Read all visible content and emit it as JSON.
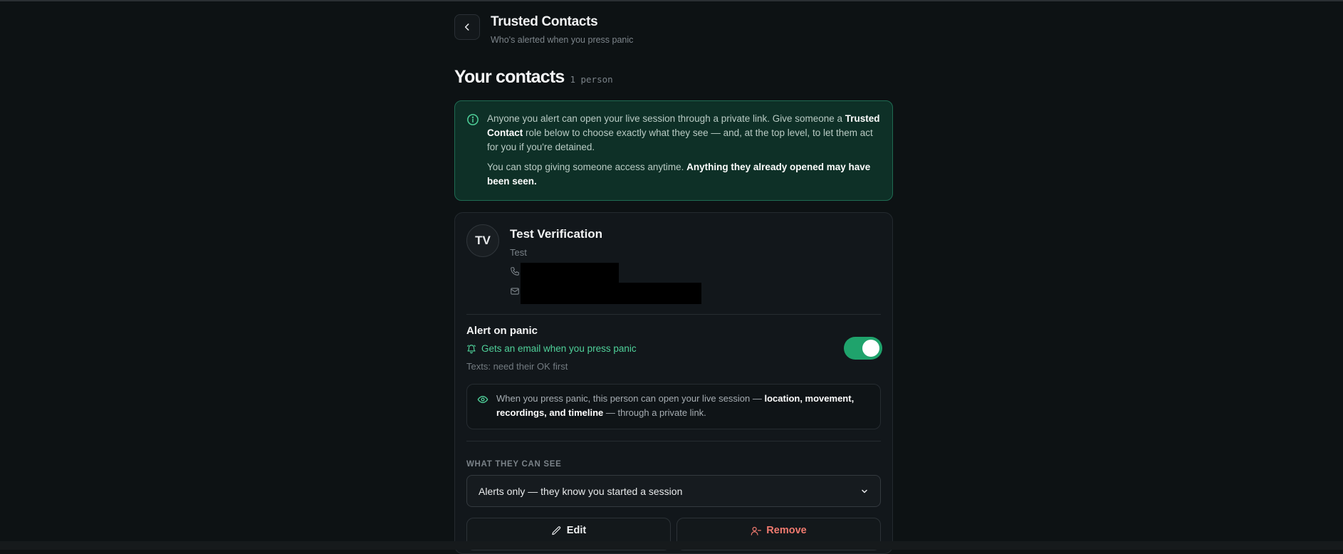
{
  "header": {
    "title": "Trusted Contacts",
    "subtitle": "Who's alerted when you press panic"
  },
  "section": {
    "title": "Your contacts",
    "count": "1 person"
  },
  "info": {
    "line1_pre": "Anyone you alert can open your live session through a private link. Give someone a ",
    "line1_bold": "Trusted Contact",
    "line1_post": " role below to choose exactly what they see — and, at the top level, to let them act for you if you're detained.",
    "line2_pre": "You can stop giving someone access anytime. ",
    "line2_bold": "Anything they already opened may have been seen."
  },
  "contact": {
    "initials": "TV",
    "name": "Test Verification",
    "relation": "Test",
    "alert": {
      "title": "Alert on panic",
      "status": "Gets an email when you press panic",
      "sms": "Texts: need their OK first",
      "enabled": true
    },
    "visibility": {
      "pre": "When you press panic, this person can open your live session — ",
      "bold": "location, movement, recordings, and timeline",
      "post": " — through a private link."
    },
    "access": {
      "label": "WHAT THEY CAN SEE",
      "selected": "Alerts only — they know you started a session"
    },
    "actions": {
      "edit": "Edit",
      "remove": "Remove"
    }
  },
  "colors": {
    "background": "#0d1214",
    "accent_green": "#4fd19a",
    "toggle_on": "#1fa36c",
    "info_bg": "#0e3027",
    "danger": "#f07a6f"
  }
}
